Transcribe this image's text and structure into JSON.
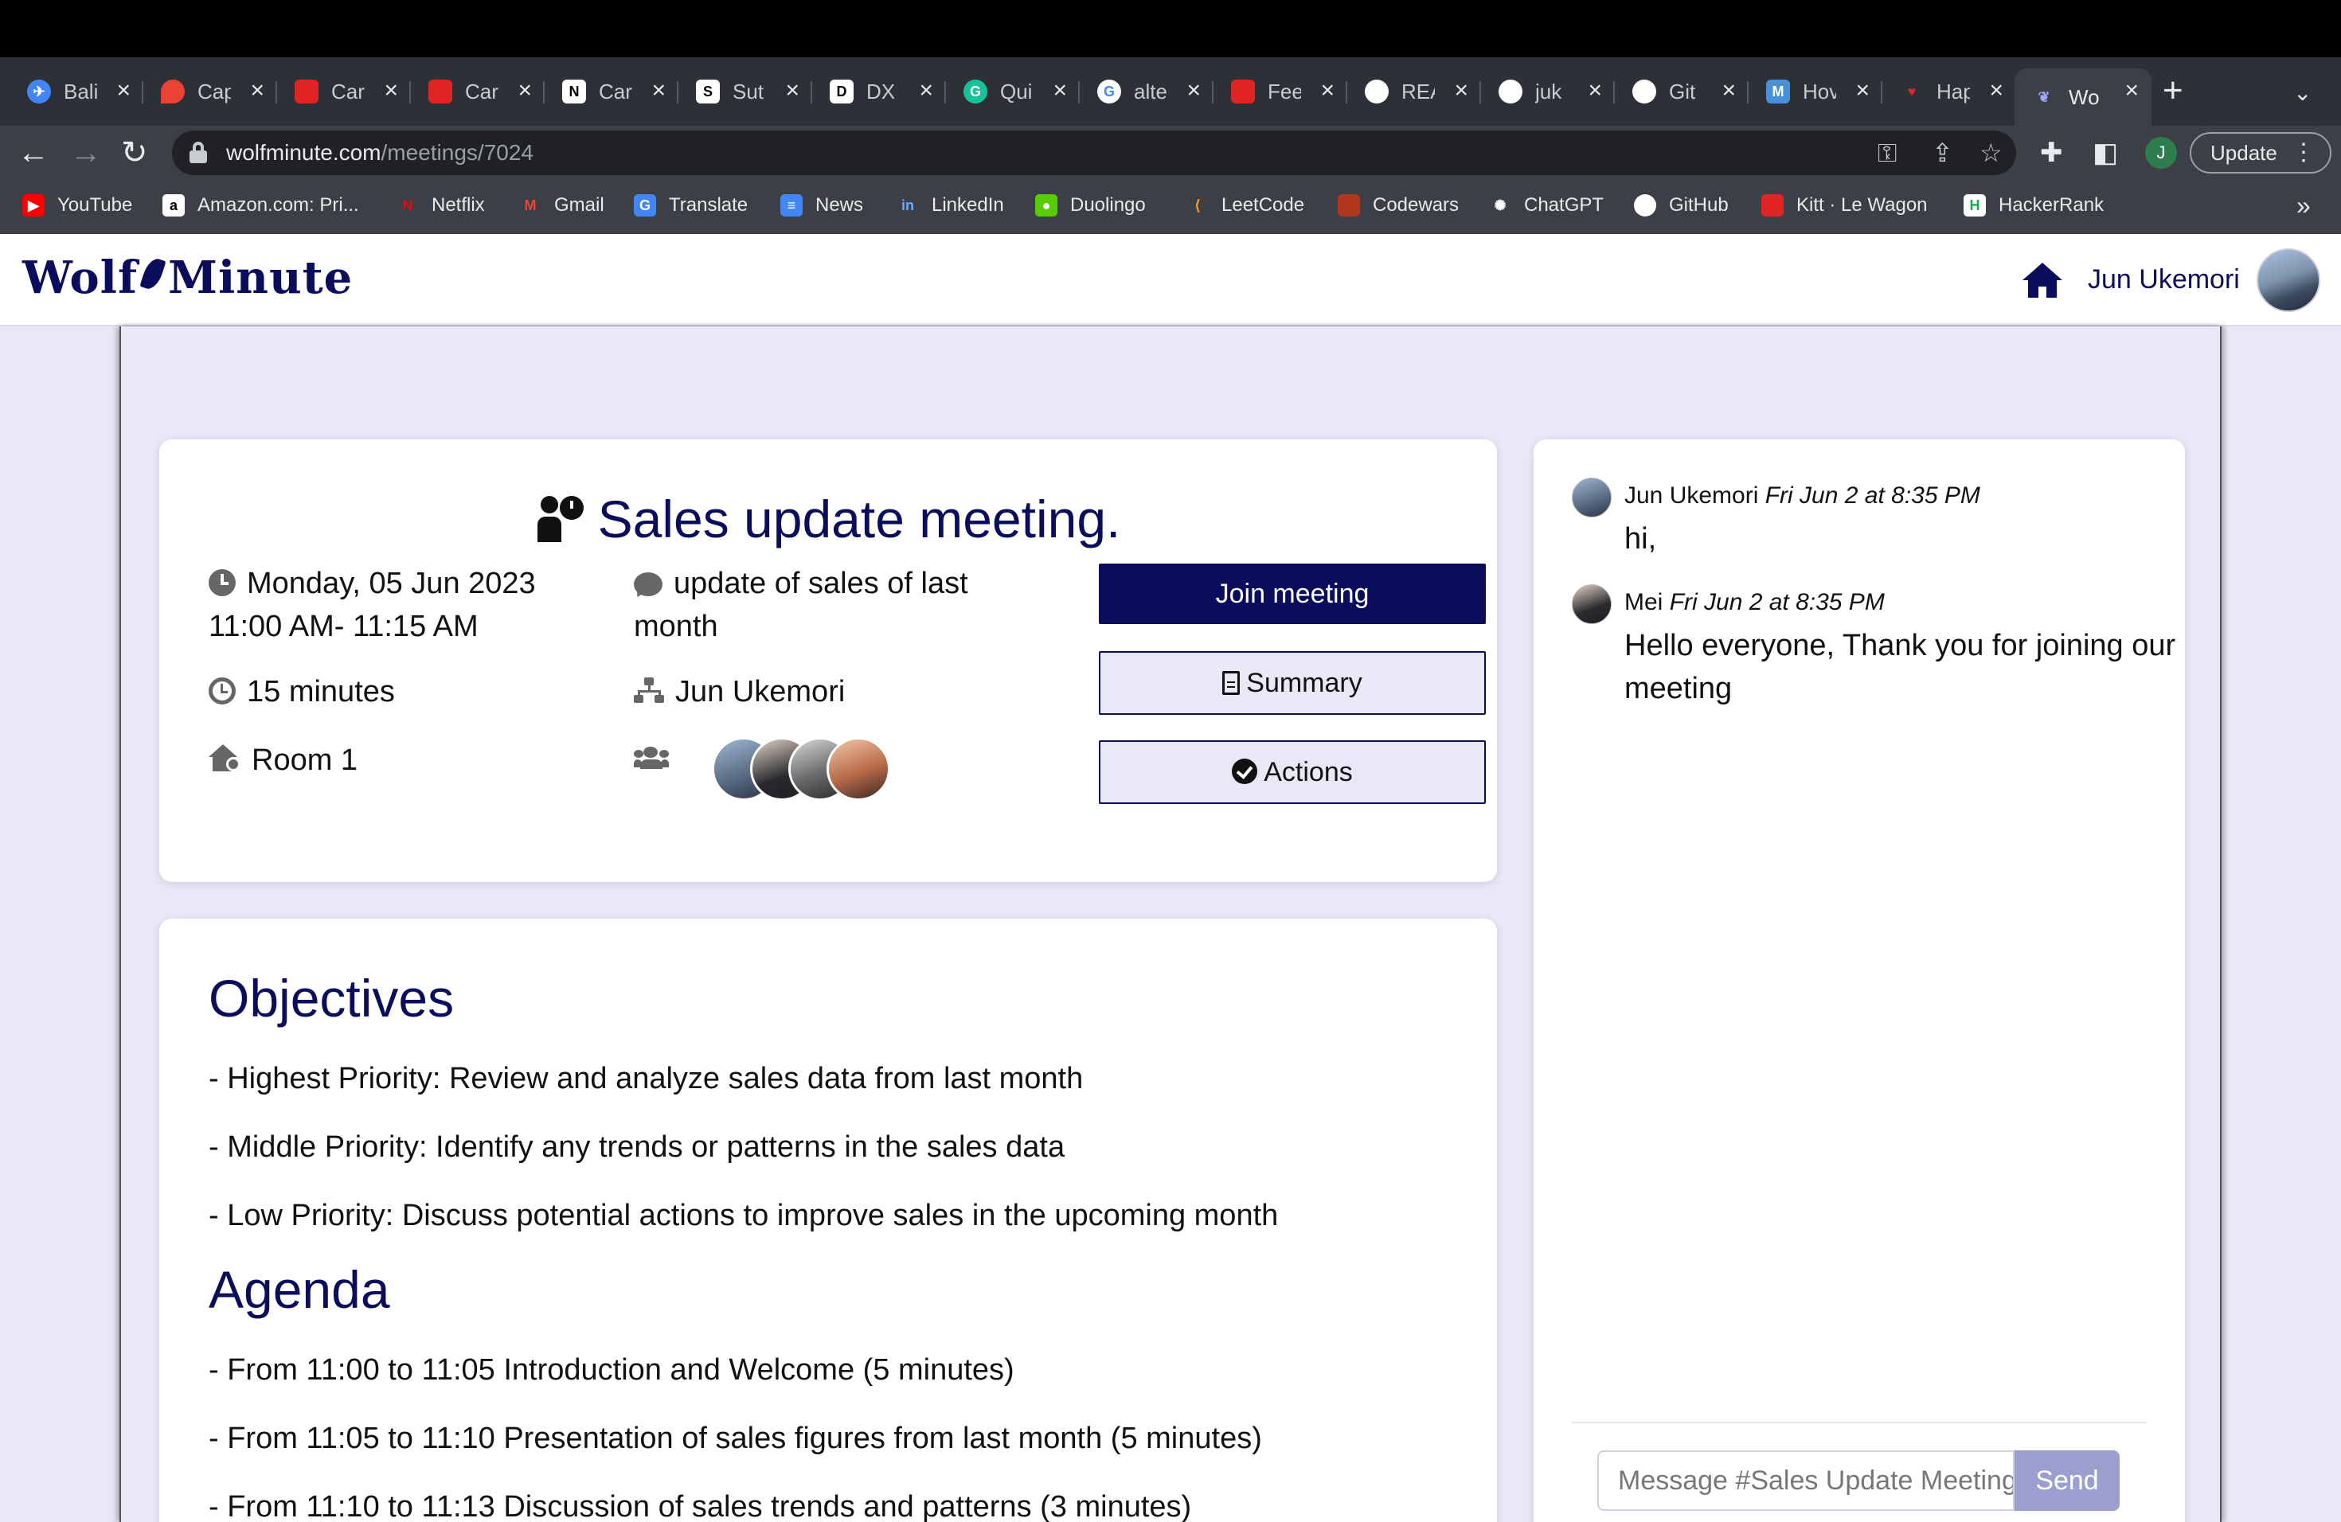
{
  "browser": {
    "tabs": [
      {
        "label": "Bali",
        "icon": "airplane-icon",
        "color": "#4285f4"
      },
      {
        "label": "Cap",
        "icon": "maps-pin-icon",
        "color": "#ea4335"
      },
      {
        "label": "Car",
        "icon": "lewagon-icon",
        "color": "#e02424"
      },
      {
        "label": "Car",
        "icon": "lewagon-icon",
        "color": "#e02424"
      },
      {
        "label": "Car",
        "icon": "notion-icon",
        "color": "#ffffff"
      },
      {
        "label": "Sut",
        "icon": "sutherland-icon",
        "color": "#ffffff"
      },
      {
        "label": "DX",
        "icon": "dx-icon",
        "color": "#ffffff"
      },
      {
        "label": "Qui",
        "icon": "grammarly-icon",
        "color": "#15c39a"
      },
      {
        "label": "alte",
        "icon": "google-icon",
        "color": "#ffffff"
      },
      {
        "label": "Fee",
        "icon": "lewagon-icon",
        "color": "#e02424"
      },
      {
        "label": "REA",
        "icon": "github-icon",
        "color": "#ffffff"
      },
      {
        "label": "juk",
        "icon": "github-icon",
        "color": "#ffffff"
      },
      {
        "label": "Git",
        "icon": "github-icon",
        "color": "#ffffff"
      },
      {
        "label": "Hov",
        "icon": "medium-icon",
        "color": "#4a90d9"
      },
      {
        "label": "Hap",
        "icon": "heart-icon",
        "color": "#e02424"
      },
      {
        "label": "Wo",
        "icon": "wolfminute-icon",
        "color": "#0a0d5c"
      }
    ],
    "url_host": "wolfminute.com",
    "url_path": "/meetings/7024",
    "profile_initial": "J",
    "update_label": "Update",
    "bookmarks": [
      {
        "label": "YouTube",
        "icon": "youtube-icon",
        "color": "#ff0000"
      },
      {
        "label": "Amazon.com: Pri...",
        "icon": "amazon-icon",
        "color": "#ffffff"
      },
      {
        "label": "Netflix",
        "icon": "netflix-icon",
        "color": "#e50914"
      },
      {
        "label": "Gmail",
        "icon": "gmail-icon",
        "color": "#ea4335"
      },
      {
        "label": "Translate",
        "icon": "translate-icon",
        "color": "#4285f4"
      },
      {
        "label": "News",
        "icon": "news-icon",
        "color": "#4285f4"
      },
      {
        "label": "LinkedIn",
        "icon": "linkedin-icon",
        "color": "#0a66c2"
      },
      {
        "label": "Duolingo",
        "icon": "duolingo-icon",
        "color": "#58cc02"
      },
      {
        "label": "LeetCode",
        "icon": "leetcode-icon",
        "color": "#ffa116"
      },
      {
        "label": "Codewars",
        "icon": "codewars-icon",
        "color": "#b1361e"
      },
      {
        "label": "ChatGPT",
        "icon": "chatgpt-icon",
        "color": "#ffffff"
      },
      {
        "label": "GitHub",
        "icon": "github-icon",
        "color": "#ffffff"
      },
      {
        "label": "Kitt · Le Wagon",
        "icon": "lewagon-icon",
        "color": "#e02424"
      },
      {
        "label": "HackerRank",
        "icon": "hackerrank-icon",
        "color": "#1ba94c"
      }
    ],
    "bookmarks_more": "»"
  },
  "app": {
    "logo_left": "Wolf",
    "logo_right": "Minute",
    "user_name": "Jun Ukemori",
    "accent_color": "#0a0d5c"
  },
  "meeting": {
    "title": "Sales update meeting.",
    "date": "Monday, 05 Jun 2023",
    "time": "11:00 AM- 11:15 AM",
    "duration": "15 minutes",
    "room": "Room 1",
    "description": "update of sales of last month",
    "organizer": "Jun Ukemori",
    "join_label": "Join meeting",
    "summary_label": "Summary",
    "actions_label": "Actions"
  },
  "objectives": {
    "heading": "Objectives",
    "items": [
      "- Highest Priority: Review and analyze sales data from last month",
      "- Middle Priority: Identify any trends or patterns in the sales data",
      "- Low Priority: Discuss potential actions to improve sales in the upcoming month"
    ]
  },
  "agenda": {
    "heading": "Agenda",
    "items": [
      "- From 11:00 to 11:05 Introduction and Welcome (5 minutes)",
      "- From 11:05 to 11:10 Presentation of sales figures from last month (5 minutes)",
      "- From 11:10 to 11:13 Discussion of sales trends and patterns (3 minutes)"
    ]
  },
  "chat": {
    "messages": [
      {
        "author": "Jun Ukemori",
        "time": "Fri Jun 2 at 8:35 PM",
        "text": "hi,"
      },
      {
        "author": "Mei",
        "time": "Fri Jun 2 at 8:35 PM",
        "text": "Hello everyone, Thank you for joining our meeting"
      }
    ],
    "input_placeholder": "Message #Sales Update Meeting",
    "send_label": "Send"
  }
}
